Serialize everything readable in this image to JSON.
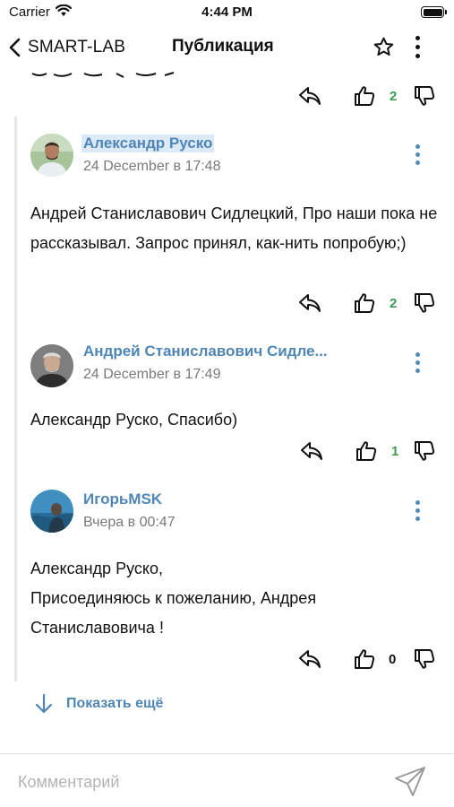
{
  "status_bar": {
    "carrier": "Carrier",
    "time": "4:44 PM"
  },
  "nav": {
    "back_label": "SMART-LAB",
    "title": "Публикация"
  },
  "top_partial": {
    "score": "2"
  },
  "comments": [
    {
      "author": "Александр Руско",
      "date": "24 December в 17:48",
      "text": "Андрей Станиславович Сидлецкий, Про наши пока не рассказывал. Запрос принял, как-нить попробую;)",
      "score": "2"
    },
    {
      "author": "Андрей Станиславович Сидле...",
      "date": "24 December в 17:49",
      "text": "Александр Руско, Спасибо)",
      "score": "1"
    },
    {
      "author": "ИгорьMSK",
      "date": "Вчера в 00:47",
      "text_lines": [
        "Александр Руско,",
        "Присоединяюсь к пожеланию, Андрея",
        "Станиславовича !"
      ],
      "score": "0"
    }
  ],
  "show_more_label": "Показать ещё",
  "composer": {
    "placeholder": "Комментарий"
  },
  "colors": {
    "link": "#4f86b6",
    "positive": "#3a9b52",
    "thread_line": "#e6e6e6"
  }
}
